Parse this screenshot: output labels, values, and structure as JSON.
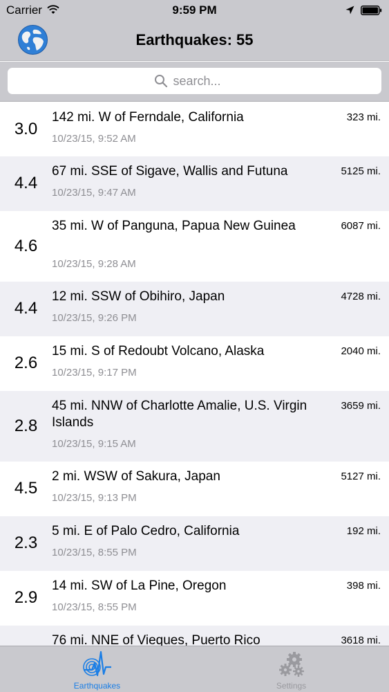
{
  "status_bar": {
    "carrier": "Carrier",
    "time": "9:59 PM"
  },
  "nav": {
    "title": "Earthquakes: 55",
    "globe_icon": "globe-icon"
  },
  "search": {
    "placeholder": "search..."
  },
  "quakes": [
    {
      "magnitude": "3.0",
      "place": "142 mi. W of Ferndale, California",
      "time": "10/23/15, 9:52 AM",
      "distance": "323 mi."
    },
    {
      "magnitude": "4.4",
      "place": "67 mi. SSE of Sigave, Wallis and Futuna",
      "time": "10/23/15, 9:47 AM",
      "distance": "5125 mi."
    },
    {
      "magnitude": "4.6",
      "place": "35 mi. W of Panguna, Papua New Guinea",
      "time": "10/23/15, 9:28 AM",
      "distance": "6087 mi."
    },
    {
      "magnitude": "4.4",
      "place": "12 mi. SSW of Obihiro, Japan",
      "time": "10/23/15, 9:26 PM",
      "distance": "4728 mi."
    },
    {
      "magnitude": "2.6",
      "place": "15 mi. S of Redoubt Volcano, Alaska",
      "time": "10/23/15, 9:17 PM",
      "distance": "2040 mi."
    },
    {
      "magnitude": "2.8",
      "place": "45 mi. NNW of Charlotte Amalie, U.S. Virgin Islands",
      "time": "10/23/15, 9:15 AM",
      "distance": "3659 mi."
    },
    {
      "magnitude": "4.5",
      "place": "2 mi. WSW of Sakura, Japan",
      "time": "10/23/15, 9:13 PM",
      "distance": "5127 mi."
    },
    {
      "magnitude": "2.3",
      "place": "5 mi. E of Palo Cedro, California",
      "time": "10/23/15, 8:55 PM",
      "distance": "192 mi."
    },
    {
      "magnitude": "2.9",
      "place": "14 mi. SW of La Pine, Oregon",
      "time": "10/23/15, 8:55 PM",
      "distance": "398 mi."
    },
    {
      "magnitude": "",
      "place": "76 mi. NNE of Vieques, Puerto Rico",
      "time": "",
      "distance": "3618 mi."
    }
  ],
  "tabs": [
    {
      "label": "Earthquakes",
      "icon": "seismograph-icon",
      "selected": true
    },
    {
      "label": "Settings",
      "icon": "gears-icon",
      "selected": false
    }
  ],
  "colors": {
    "bar_background": "#c9c9ce",
    "alt_row": "#efeff4",
    "accent": "#1a7ee6",
    "secondary_text": "#8e8e93"
  }
}
